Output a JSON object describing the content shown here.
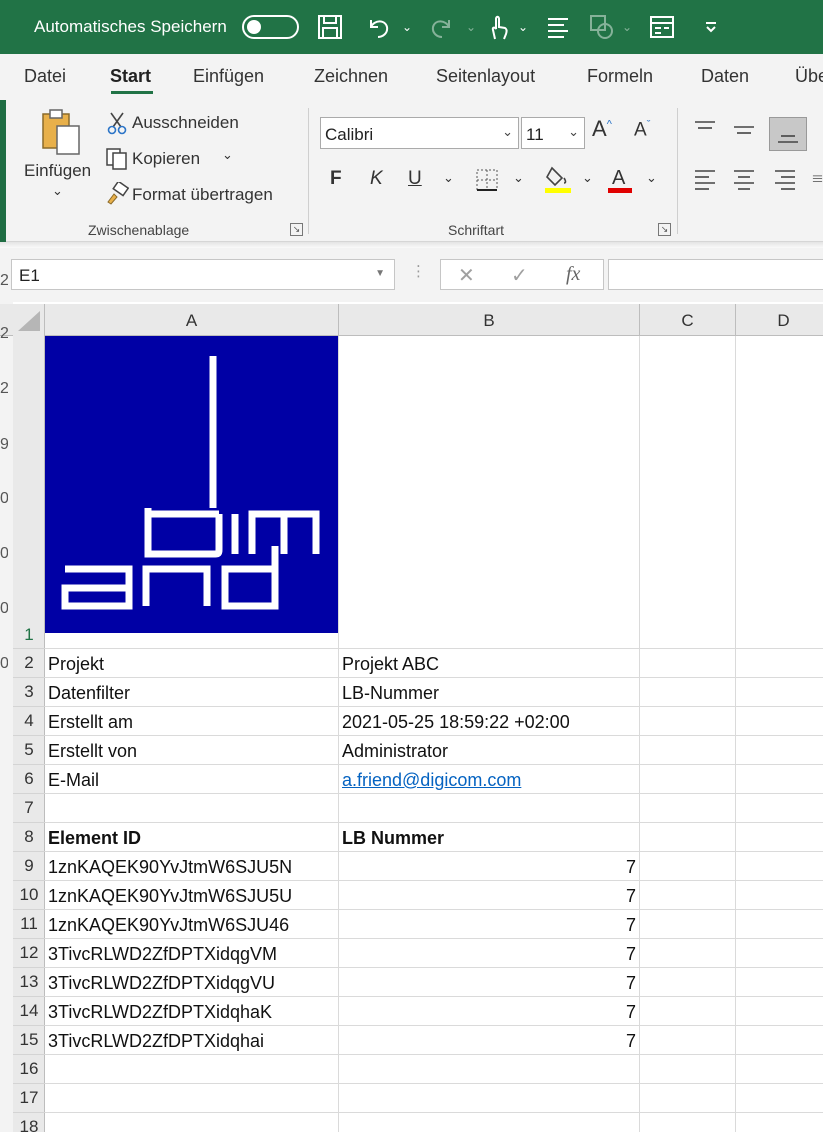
{
  "titlebar": {
    "autosave_label": "Automatisches Speichern",
    "autosave_on": false,
    "icons": [
      "save-icon",
      "undo-icon",
      "redo-icon",
      "touch-mode-icon",
      "list-icon",
      "shapes-icon",
      "form-icon",
      "customize-toolbar-icon"
    ]
  },
  "ribbon_tabs": [
    "Datei",
    "Start",
    "Einfügen",
    "Zeichnen",
    "Seitenlayout",
    "Formeln",
    "Daten",
    "Übe"
  ],
  "active_tab": "Start",
  "clipboard": {
    "paste_label": "Einfügen",
    "cut_label": "Ausschneiden",
    "copy_label": "Kopieren",
    "format_painter_label": "Format übertragen",
    "group_label": "Zwischenablage"
  },
  "font": {
    "font_name": "Calibri",
    "font_size": "11",
    "bold": "F",
    "italic": "K",
    "underline": "U",
    "grow_font": "A",
    "shrink_font": "A",
    "font_color_letter": "A",
    "highlight_color": "#ffff00",
    "font_color": "#e00000",
    "group_label": "Schriftart"
  },
  "formula_bar": {
    "name_box": "E1",
    "cancel": "✕",
    "enter": "✓",
    "fx": "fx",
    "value": ""
  },
  "columns": [
    "A",
    "B",
    "C",
    "D"
  ],
  "rows": [
    "1",
    "2",
    "3",
    "4",
    "5",
    "6",
    "7",
    "8",
    "9",
    "10",
    "11",
    "12",
    "13",
    "14",
    "15",
    "16",
    "17",
    "18"
  ],
  "left_edge_digits": [
    "2",
    "2",
    "2",
    "9",
    "0",
    "0",
    "0",
    "0"
  ],
  "logo": {
    "text_top": "bim",
    "text_bottom": "and",
    "background": "#0000a5"
  },
  "cells": {
    "A2": "Projekt",
    "B2": "Projekt ABC",
    "A3": "Datenfilter",
    "B3": "LB-Nummer",
    "A4": "Erstellt am",
    "B4": "2021-05-25 18:59:22 +02:00",
    "A5": "Erstellt von",
    "B5": "Administrator",
    "A6": "E-Mail",
    "B6": "a.friend@digicom.com",
    "A8": "Element ID",
    "B8": "LB Nummer"
  },
  "table_rows": [
    {
      "element_id": "1znKAQEK90YvJtmW6SJU5N",
      "lb_nummer": "7"
    },
    {
      "element_id": "1znKAQEK90YvJtmW6SJU5U",
      "lb_nummer": "7"
    },
    {
      "element_id": "1znKAQEK90YvJtmW6SJU46",
      "lb_nummer": "7"
    },
    {
      "element_id": "3TivcRLWD2ZfDPTXidqgVM",
      "lb_nummer": "7"
    },
    {
      "element_id": "3TivcRLWD2ZfDPTXidqgVU",
      "lb_nummer": "7"
    },
    {
      "element_id": "3TivcRLWD2ZfDPTXidqhaK",
      "lb_nummer": "7"
    },
    {
      "element_id": "3TivcRLWD2ZfDPTXidqhai",
      "lb_nummer": "7"
    }
  ],
  "colors": {
    "excel_green": "#217346",
    "link": "#0563c1"
  }
}
